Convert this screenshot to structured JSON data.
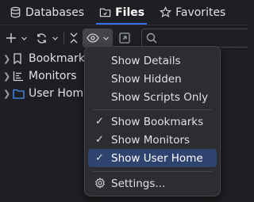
{
  "tabs": [
    {
      "label": "Databases",
      "icon": "database-icon"
    },
    {
      "label": "Files",
      "icon": "folder-icon",
      "active": true
    },
    {
      "label": "Favorites",
      "icon": "star-icon"
    }
  ],
  "toolbar": {
    "add_icon": "plus-icon",
    "refresh_icon": "refresh-icon",
    "collapse_icon": "collapse-icon",
    "view_options_icon": "eye-icon",
    "open_icon": "open-in-icon",
    "search_icon": "search-icon",
    "search_value": ""
  },
  "tree": {
    "items": [
      {
        "label": "Bookmarks",
        "icon": "bookmark-icon"
      },
      {
        "label": "Monitors",
        "icon": "chart-icon"
      },
      {
        "label": "User Home",
        "icon": "folder-icon"
      }
    ]
  },
  "menu": {
    "items": [
      {
        "label": "Show Details",
        "checked": false
      },
      {
        "label": "Show Hidden",
        "checked": false
      },
      {
        "label": "Show Scripts Only",
        "checked": false
      },
      {
        "label": "Show Bookmarks",
        "checked": true
      },
      {
        "label": "Show Monitors",
        "checked": true
      },
      {
        "label": "Show User Home",
        "checked": true,
        "selected": true
      },
      {
        "label": "Settings...",
        "icon": "gear-icon"
      }
    ],
    "check_glyph": "✓"
  },
  "colors": {
    "background": "#1e1f22",
    "menu_background": "#2b2d30",
    "selection": "#2e436e",
    "accent": "#3574f0",
    "folder_blue": "#4c8cf5"
  }
}
